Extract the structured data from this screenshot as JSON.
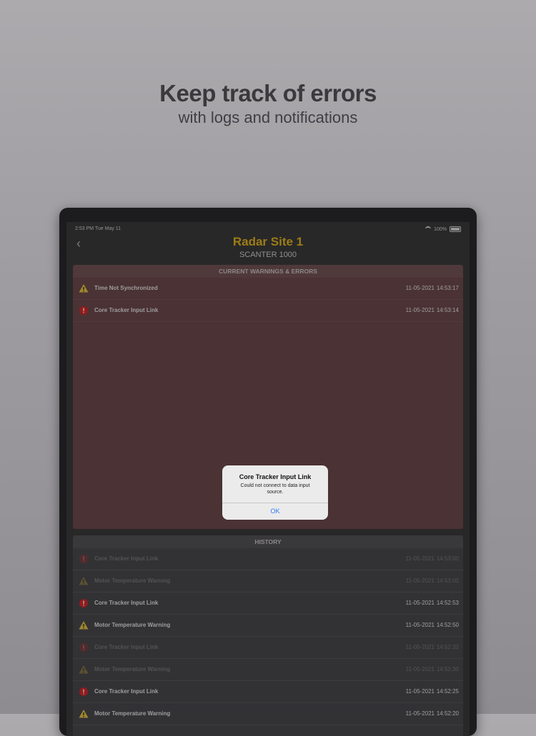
{
  "headline": {
    "title": "Keep track of errors",
    "subtitle": "with logs and notifications"
  },
  "status_bar": {
    "time": "2:53 PM Tue May 11",
    "battery": "100%"
  },
  "nav": {
    "title": "Radar Site 1",
    "subtitle": "SCANTER 1000"
  },
  "warnings": {
    "header": "CURRENT WARNINGS & ERRORS",
    "rows": [
      {
        "icon": "warning-triangle-icon",
        "label": "Time Not Synchronized",
        "date": "11-05-2021",
        "time": "14:53:17"
      },
      {
        "icon": "error-circle-icon",
        "label": "Core Tracker Input Link",
        "date": "11-05-2021",
        "time": "14:53:14"
      }
    ]
  },
  "history": {
    "header": "HISTORY",
    "rows": [
      {
        "icon": "error-circle-icon",
        "label": "Core Tracker Input Link",
        "date": "11-05-2021",
        "time": "14:53:00",
        "dim": true
      },
      {
        "icon": "warning-triangle-icon",
        "label": "Motor Temperature Warning",
        "date": "11-05-2021",
        "time": "14:53:00",
        "dim": true
      },
      {
        "icon": "error-circle-icon",
        "label": "Core Tracker Input Link",
        "date": "11-05-2021",
        "time": "14:52:53",
        "dim": false
      },
      {
        "icon": "warning-triangle-icon",
        "label": "Motor Temperature Warning",
        "date": "11-05-2021",
        "time": "14:52:50",
        "dim": false
      },
      {
        "icon": "error-circle-icon",
        "label": "Core Tracker Input Link",
        "date": "11-05-2021",
        "time": "14:52:32",
        "dim": true
      },
      {
        "icon": "warning-triangle-icon",
        "label": "Motor Temperature Warning",
        "date": "11-05-2021",
        "time": "14:52:30",
        "dim": true
      },
      {
        "icon": "error-circle-icon",
        "label": "Core Tracker Input Link",
        "date": "11-05-2021",
        "time": "14:52:25",
        "dim": false
      },
      {
        "icon": "warning-triangle-icon",
        "label": "Motor Temperature Warning",
        "date": "11-05-2021",
        "time": "14:52:20",
        "dim": false
      }
    ]
  },
  "alert": {
    "title": "Core Tracker Input Link",
    "message": "Could not connect to data input source.",
    "ok_label": "OK"
  },
  "colors": {
    "accent_title": "#e8b820",
    "warning_yellow": "#e8c84a",
    "error_red": "#d8282c",
    "warnings_panel": "#6f4a4d",
    "history_panel": "#4b4b4e",
    "link_blue": "#2a7af0"
  }
}
